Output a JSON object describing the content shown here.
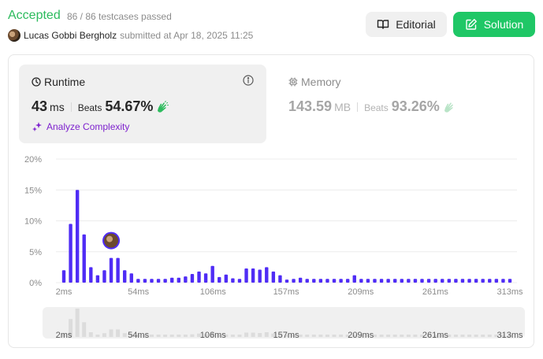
{
  "header": {
    "status": "Accepted",
    "testcases": "86 / 86 testcases passed",
    "user_name": "Lucas Gobbi Bergholz",
    "submitted_text": "submitted at Apr 18, 2025 11:25",
    "editorial_label": "Editorial",
    "solution_label": "Solution"
  },
  "runtime": {
    "title": "Runtime",
    "value": "43",
    "unit": "ms",
    "beats_label": "Beats",
    "beats_value": "54.67%",
    "analyze_label": "Analyze Complexity"
  },
  "memory": {
    "title": "Memory",
    "value": "143.59",
    "unit": "MB",
    "beats_label": "Beats",
    "beats_value": "93.26%"
  },
  "colors": {
    "accepted": "#2cbb5d",
    "solution_button": "#1fc766",
    "bar": "#4f2cf5",
    "analyze": "#7e22ce",
    "scrub_bar": "#dcdcdc"
  },
  "chart_data": {
    "type": "bar",
    "title": "",
    "xlabel": "",
    "ylabel": "",
    "ylim": [
      0,
      20
    ],
    "y_ticks": [
      "0%",
      "5%",
      "10%",
      "15%",
      "20%"
    ],
    "x_tick_labels": [
      "2ms",
      "54ms",
      "106ms",
      "157ms",
      "209ms",
      "261ms",
      "313ms"
    ],
    "x_range_ms": [
      2,
      313
    ],
    "bin_width_ms": 5.8,
    "highlight_runtime_ms": 43,
    "values": [
      2.0,
      9.5,
      15.0,
      7.8,
      2.5,
      1.2,
      2.0,
      4.0,
      4.0,
      2.0,
      1.5,
      0.6,
      0.6,
      0.6,
      0.6,
      0.6,
      0.8,
      0.8,
      1.0,
      1.4,
      1.8,
      1.5,
      2.7,
      0.9,
      1.3,
      0.7,
      0.6,
      2.3,
      2.3,
      2.1,
      2.5,
      1.8,
      1.2,
      0.5,
      0.6,
      0.8,
      0.6,
      0.6,
      0.6,
      0.6,
      0.6,
      0.6,
      0.6,
      1.2,
      0.6,
      0.6,
      0.6,
      0.6,
      0.6,
      0.6,
      0.6,
      0.6,
      0.6,
      0.6,
      0.6,
      0.6,
      0.6,
      0.6,
      0.6,
      0.6,
      0.6,
      0.6,
      0.6,
      0.6,
      0.6,
      0.6,
      0.6
    ]
  }
}
